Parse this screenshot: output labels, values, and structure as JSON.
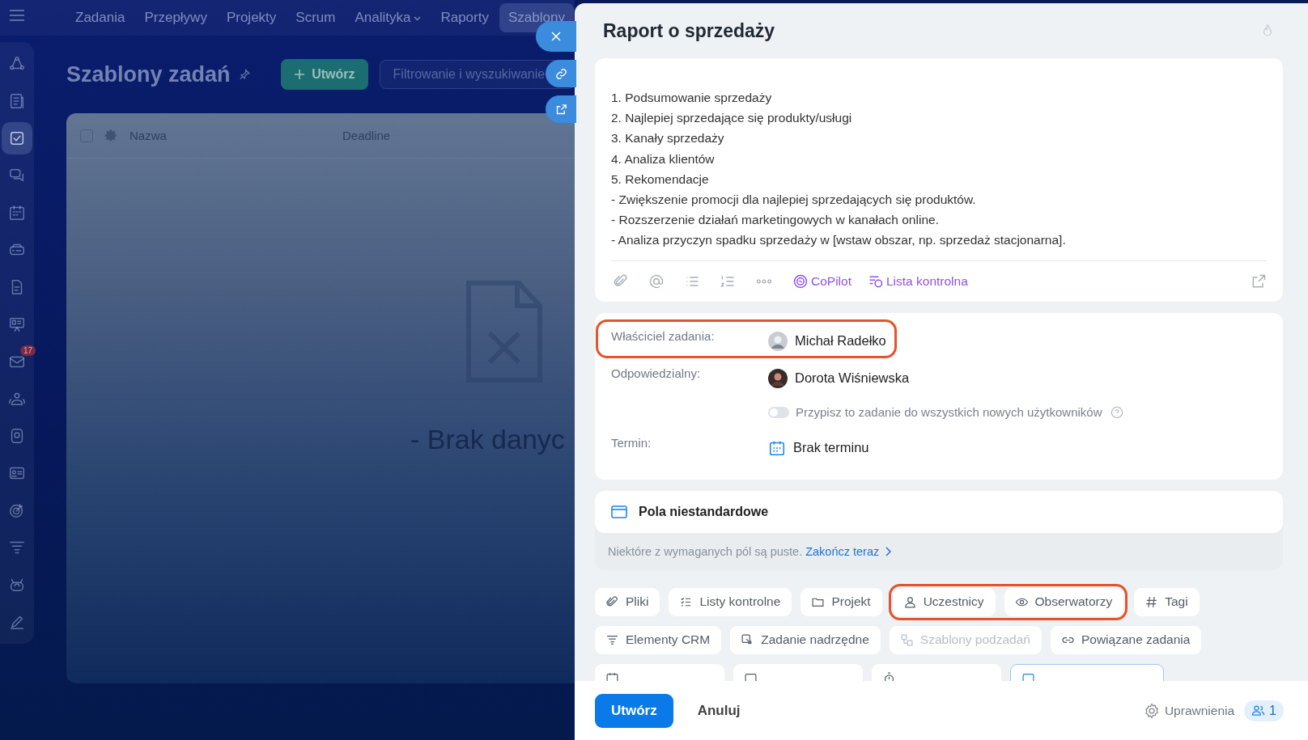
{
  "top_nav": {
    "tabs": [
      {
        "label": "Zadania",
        "selected": false,
        "dropdown": false
      },
      {
        "label": "Przepływy",
        "selected": false,
        "dropdown": false
      },
      {
        "label": "Projekty",
        "selected": false,
        "dropdown": false
      },
      {
        "label": "Scrum",
        "selected": false,
        "dropdown": false
      },
      {
        "label": "Analityka",
        "selected": false,
        "dropdown": true
      },
      {
        "label": "Raporty",
        "selected": false,
        "dropdown": false
      },
      {
        "label": "Szablony",
        "selected": true,
        "dropdown": false
      }
    ]
  },
  "sidebar": {
    "items": [
      {
        "kind": "flow",
        "selected": false
      },
      {
        "kind": "news",
        "selected": false
      },
      {
        "kind": "tasks",
        "selected": true
      },
      {
        "kind": "chat",
        "selected": false
      },
      {
        "kind": "calendar",
        "selected": false
      },
      {
        "kind": "drive",
        "selected": false
      },
      {
        "kind": "doc",
        "selected": false
      },
      {
        "kind": "board",
        "selected": false
      },
      {
        "kind": "mail",
        "selected": false,
        "badge": "17"
      },
      {
        "kind": "people",
        "selected": false
      },
      {
        "kind": "scan",
        "selected": false
      },
      {
        "kind": "card",
        "selected": false
      },
      {
        "kind": "target",
        "selected": false
      },
      {
        "kind": "funnel",
        "selected": false
      },
      {
        "kind": "robot",
        "selected": false
      },
      {
        "kind": "pen",
        "selected": false
      }
    ]
  },
  "page": {
    "title": "Szablony zadań",
    "create_button": "Utwórz",
    "search": {
      "placeholder": "Filtrowanie i wyszukiwanie"
    }
  },
  "table": {
    "all_selected": false,
    "columns": [
      "Nazwa",
      "Deadline"
    ],
    "empty_text": "- Brak danyc"
  },
  "panel": {
    "title": "Raport o sprzedaży",
    "description": [
      "1. Podsumowanie sprzedaży",
      "2. Najlepiej sprzedające się produkty/usługi",
      "3. Kanały sprzedaży",
      "4. Analiza klientów",
      "5. Rekomendacje",
      "- Zwiększenie promocji dla najlepiej sprzedających się produktów.",
      "- Rozszerzenie działań marketingowych w kanałach online.",
      "- Analiza przyczyn spadku sprzedaży w [wstaw obszar, np. sprzedaż stacjonarna]."
    ],
    "toolbar_links": [
      {
        "kind": "copilot",
        "label": "CoPilot"
      },
      {
        "kind": "checklist",
        "label": "Lista kontrolna"
      }
    ],
    "fields": [
      {
        "kind": "person",
        "label": "Właściciel zadania:",
        "value": "Michał Radełko",
        "highlighted": true
      },
      {
        "kind": "person",
        "label": "Odpowiedzialny:",
        "value": "Dorota Wiśniewska",
        "highlighted": false
      },
      {
        "kind": "toggle",
        "label": "Przypisz to zadanie do wszystkich nowych użytkowników",
        "on": false
      },
      {
        "kind": "date",
        "label": "Termin:",
        "value": "Brak terminu",
        "highlighted": false
      }
    ],
    "custom_fields": {
      "title": "Pola niestandardowe",
      "note": "Niektóre z wymaganych pól są puste.",
      "link": "Zakończ teraz"
    },
    "chip_rows": [
      [
        {
          "kind": "clip",
          "label": "Pliki",
          "disabled": false,
          "highlighted": false
        },
        {
          "kind": "list",
          "label": "Listy kontrolne",
          "disabled": false,
          "highlighted": false
        },
        {
          "kind": "folder",
          "label": "Projekt",
          "disabled": false,
          "highlighted": false
        },
        {
          "kind": "person",
          "label": "Uczestnicy",
          "disabled": false,
          "highlighted": true
        },
        {
          "kind": "eye",
          "label": "Obserwatorzy",
          "disabled": false,
          "highlighted": true
        },
        {
          "kind": "hash",
          "label": "Tagi",
          "disabled": false,
          "highlighted": false
        }
      ],
      [
        {
          "kind": "funnel",
          "label": "Elementy CRM",
          "disabled": false,
          "highlighted": false
        },
        {
          "kind": "parent",
          "label": "Zadanie nadrzędne",
          "disabled": false,
          "highlighted": false
        },
        {
          "kind": "subtasks",
          "label": "Szablony podzadań",
          "disabled": true,
          "highlighted": false
        },
        {
          "kind": "link",
          "label": "Powiązane zadania",
          "disabled": false,
          "highlighted": false
        }
      ],
      [
        {
          "kind": "calendar",
          "disabled": false
        },
        {
          "kind": "square",
          "disabled": false
        },
        {
          "kind": "timer",
          "disabled": false
        },
        {
          "kind": "square",
          "disabled": false,
          "selected": true
        }
      ]
    ]
  },
  "footer": {
    "primary": "Utwórz",
    "cancel": "Anuluj",
    "permissions": "Uprawnienia",
    "count": "1"
  }
}
